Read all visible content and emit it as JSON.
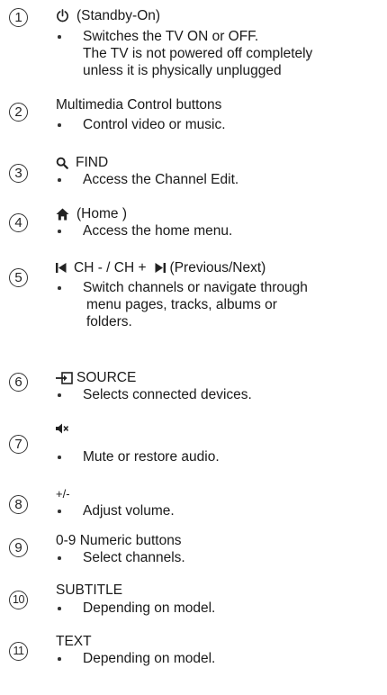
{
  "items": [
    {
      "number": "1",
      "icon": "power-icon",
      "title": "(Standby-On)",
      "bullets": [
        "Switches the TV ON or OFF."
      ],
      "extra_lines": [
        "The TV is not powered off completely",
        "unless it is physically unplugged"
      ]
    },
    {
      "number": "2",
      "title": "Multimedia Control buttons",
      "bullets": [
        "Control video or music."
      ]
    },
    {
      "number": "3",
      "icon": "search-icon",
      "title": "FIND",
      "bullets": [
        "Access the Channel Edit."
      ]
    },
    {
      "number": "4",
      "icon": "home-icon",
      "title": "(Home )",
      "bullets": [
        "Access the home menu."
      ]
    },
    {
      "number": "5",
      "icon": "previous-icon",
      "title": "CH - / CH +",
      "icon2": "next-icon",
      "title_suffix": "(Previous/Next)",
      "bullets": [
        "Switch channels or navigate through"
      ],
      "extra_lines": [
        "menu pages, tracks, albums or",
        "folders."
      ]
    },
    {
      "number": "6",
      "icon": "source-icon",
      "title": "SOURCE",
      "bullets": [
        "Selects connected devices."
      ]
    },
    {
      "number": "7",
      "icon": "mute-icon",
      "title": "",
      "bullets": [
        "Mute or restore audio."
      ]
    },
    {
      "number": "8",
      "title": "+/-",
      "bullets": [
        "Adjust volume."
      ]
    },
    {
      "number": "9",
      "title": "0-9 Numeric buttons",
      "bullets": [
        "Select channels."
      ]
    },
    {
      "number": "10",
      "title": "SUBTITLE",
      "bullets": [
        "Depending on model."
      ]
    },
    {
      "number": "11",
      "title": "TEXT",
      "bullets": [
        "Depending on model."
      ]
    }
  ]
}
